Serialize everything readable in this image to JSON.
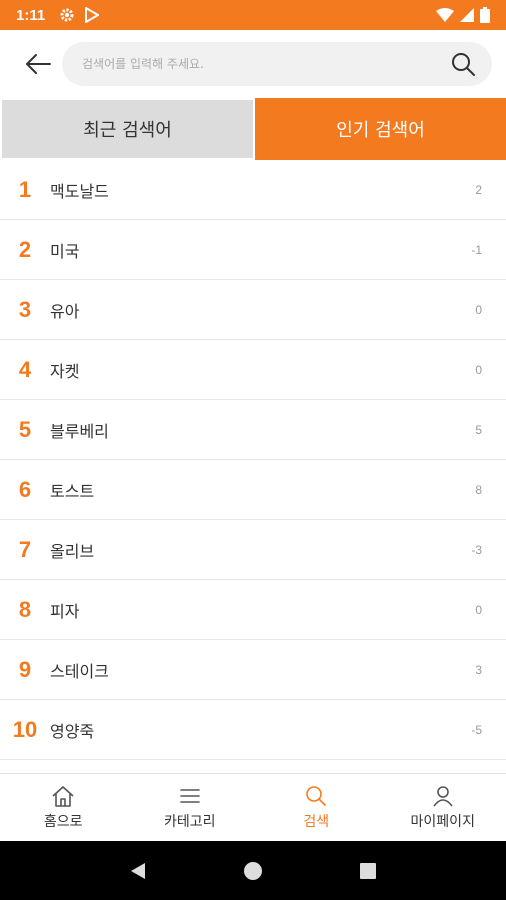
{
  "status_bar": {
    "time": "1:11",
    "icons": [
      "gear-icon",
      "play-store-icon",
      "wifi-icon",
      "signal-icon",
      "battery-icon"
    ]
  },
  "search": {
    "placeholder": "검색어를 입력해 주세요.",
    "value": ""
  },
  "tabs": [
    {
      "label": "최근 검색어",
      "active": false
    },
    {
      "label": "인기 검색어",
      "active": true
    }
  ],
  "rankings": [
    {
      "rank": "1",
      "keyword": "맥도날드",
      "change": "2"
    },
    {
      "rank": "2",
      "keyword": "미국",
      "change": "-1"
    },
    {
      "rank": "3",
      "keyword": "유아",
      "change": "0"
    },
    {
      "rank": "4",
      "keyword": "자켓",
      "change": "0"
    },
    {
      "rank": "5",
      "keyword": "블루베리",
      "change": "5"
    },
    {
      "rank": "6",
      "keyword": "토스트",
      "change": "8"
    },
    {
      "rank": "7",
      "keyword": "올리브",
      "change": "-3"
    },
    {
      "rank": "8",
      "keyword": "피자",
      "change": "0"
    },
    {
      "rank": "9",
      "keyword": "스테이크",
      "change": "3"
    },
    {
      "rank": "10",
      "keyword": "영양죽",
      "change": "-5"
    }
  ],
  "bottom_nav": [
    {
      "label": "홈으로",
      "icon": "home-icon",
      "active": false
    },
    {
      "label": "카테고리",
      "icon": "menu-icon",
      "active": false
    },
    {
      "label": "검색",
      "icon": "search-icon",
      "active": true
    },
    {
      "label": "마이페이지",
      "icon": "person-icon",
      "active": false
    }
  ],
  "colors": {
    "accent": "#f47a20",
    "tab_inactive": "#dcdcdc",
    "text": "#333333",
    "muted": "#999999"
  }
}
